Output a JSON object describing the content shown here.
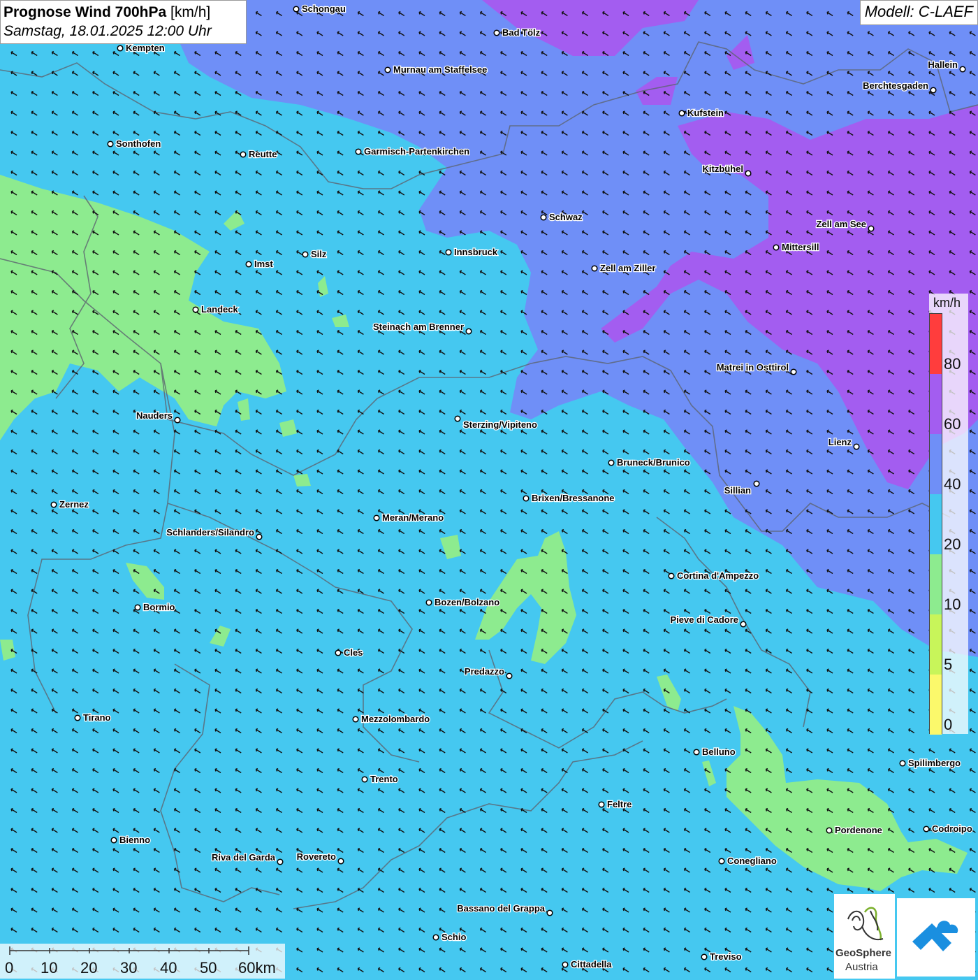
{
  "title": {
    "bold": "Prognose Wind 700hPa",
    "unit": "[km/h]",
    "date": "Samstag, 18.01.2025 12:00 Uhr"
  },
  "model": "Modell: C-LAEF",
  "legend": {
    "unit": "km/h",
    "labels": [
      "80",
      "60",
      "40",
      "20",
      "10",
      "5",
      "0"
    ],
    "colors": {
      "80_plus": "#ff3d3d",
      "60_80": "#a35df0",
      "40_60": "#6f8ff7",
      "20_40": "#45c8f0",
      "10_20": "#8deb8f",
      "5_10": "#c8f55a",
      "0_5": "#fbf96b"
    }
  },
  "scale_bar": {
    "labels": [
      "0",
      "10",
      "20",
      "30",
      "40",
      "50",
      "60km"
    ]
  },
  "logos": {
    "geosphere_line1": "GeoSphere",
    "geosphere_line2": "Austria"
  },
  "cities": [
    {
      "name": "Schongau"
    },
    {
      "name": "Bad Tölz"
    },
    {
      "name": "Kempten"
    },
    {
      "name": "Murnau am Staffelsee"
    },
    {
      "name": "Hallein"
    },
    {
      "name": "Berchtesgaden"
    },
    {
      "name": "Kufstein"
    },
    {
      "name": "Sonthofen"
    },
    {
      "name": "Reutte"
    },
    {
      "name": "Garmisch-Partenkirchen"
    },
    {
      "name": "Kitzbühel"
    },
    {
      "name": "Schwaz"
    },
    {
      "name": "Zell am See"
    },
    {
      "name": "Mittersill"
    },
    {
      "name": "Imst"
    },
    {
      "name": "Silz"
    },
    {
      "name": "Innsbruck"
    },
    {
      "name": "Zell am Ziller"
    },
    {
      "name": "Landeck"
    },
    {
      "name": "Steinach am Brenner"
    },
    {
      "name": "Matrei in Osttirol"
    },
    {
      "name": "Nauders"
    },
    {
      "name": "Sterzing/Vipiteno"
    },
    {
      "name": "Lienz"
    },
    {
      "name": "Bruneck/Brunico"
    },
    {
      "name": "Sillian"
    },
    {
      "name": "Zernez"
    },
    {
      "name": "Brixen/Bressanone"
    },
    {
      "name": "Meran/Merano"
    },
    {
      "name": "Schlanders/Silandro"
    },
    {
      "name": "Cortina d'Ampezzo"
    },
    {
      "name": "Bozen/Bolzano"
    },
    {
      "name": "Bormio"
    },
    {
      "name": "Pieve di Cadore"
    },
    {
      "name": "Cles"
    },
    {
      "name": "Predazzo"
    },
    {
      "name": "Tirano"
    },
    {
      "name": "Mezzolombardo"
    },
    {
      "name": "Belluno"
    },
    {
      "name": "Spilimbergo"
    },
    {
      "name": "Trento"
    },
    {
      "name": "Feltre"
    },
    {
      "name": "Pordenone"
    },
    {
      "name": "Codroipo"
    },
    {
      "name": "Bienno"
    },
    {
      "name": "Riva del Garda"
    },
    {
      "name": "Rovereto"
    },
    {
      "name": "Conegliano"
    },
    {
      "name": "Bassano del Grappa"
    },
    {
      "name": "Schio"
    },
    {
      "name": "Treviso"
    },
    {
      "name": "Cittadella"
    }
  ]
}
